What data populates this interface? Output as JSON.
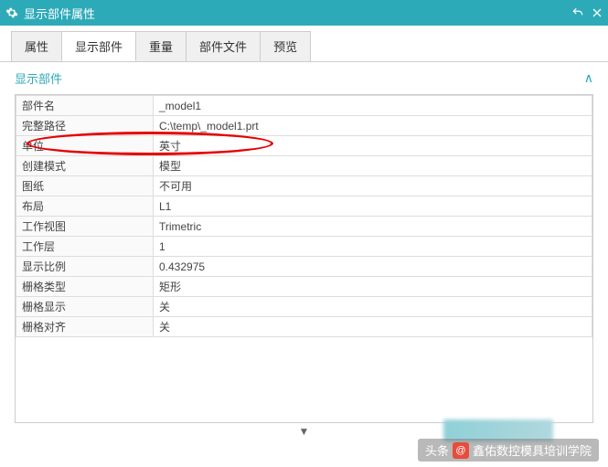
{
  "window": {
    "title": "显示部件属性"
  },
  "tabs": {
    "t0": "属性",
    "t1": "显示部件",
    "t2": "重量",
    "t3": "部件文件",
    "t4": "预览"
  },
  "section": {
    "title": "显示部件"
  },
  "props": {
    "labels": {
      "name": "部件名",
      "path": "完整路径",
      "unit": "单位",
      "mode": "创建模式",
      "drawing": "图纸",
      "layout": "布局",
      "view": "工作视图",
      "layer": "工作层",
      "scale": "显示比例",
      "gridtype": "栅格类型",
      "gridshow": "栅格显示",
      "gridalign": "栅格对齐"
    },
    "values": {
      "name": "_model1",
      "path": "C:\\temp\\_model1.prt",
      "unit": "英寸",
      "mode": "模型",
      "drawing": "不可用",
      "layout": "L1",
      "view": "Trimetric",
      "layer": "1",
      "scale": "0.432975",
      "gridtype": "矩形",
      "gridshow": "关",
      "gridalign": "关"
    }
  },
  "watermark": {
    "prefix": "头条",
    "at": "@",
    "name": "鑫佑数控模具培训学院"
  }
}
